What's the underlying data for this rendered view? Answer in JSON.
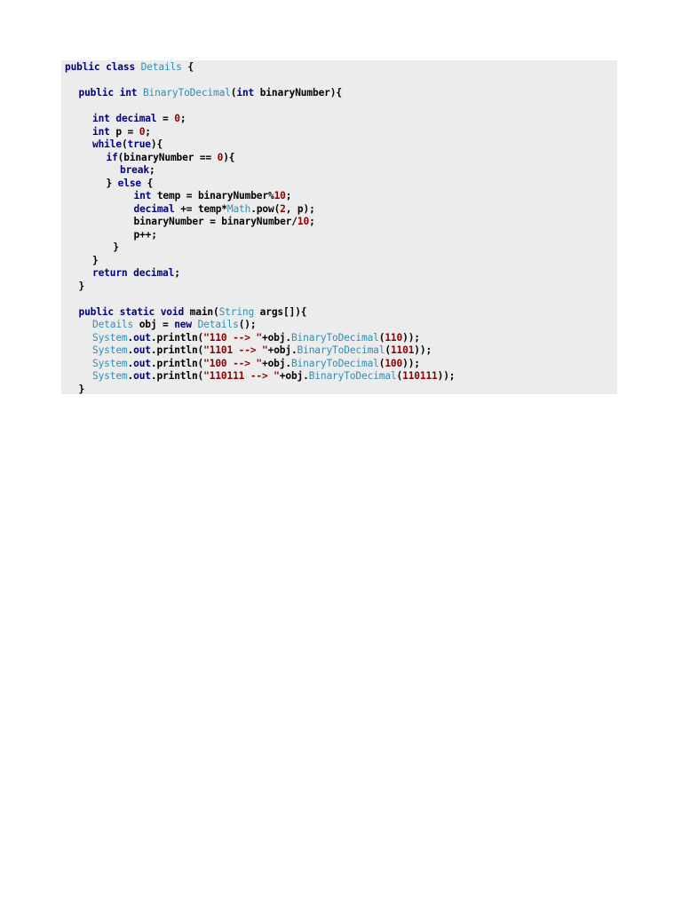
{
  "colors": {
    "background": "#ececec",
    "keyword": "#000080",
    "type": "#2e8fb4",
    "literal": "#8b0000",
    "text": "#000000"
  },
  "code": {
    "lines": [
      {
        "indent": 0,
        "tokens": [
          {
            "t": "public",
            "c": "kw"
          },
          {
            "t": " "
          },
          {
            "t": "class",
            "c": "kw"
          },
          {
            "t": " "
          },
          {
            "t": "Details",
            "c": "ty"
          },
          {
            "t": " {",
            "c": "id"
          }
        ]
      },
      {
        "indent": 0,
        "tokens": []
      },
      {
        "indent": 2,
        "tokens": [
          {
            "t": "public",
            "c": "kw"
          },
          {
            "t": " "
          },
          {
            "t": "int",
            "c": "kw"
          },
          {
            "t": " "
          },
          {
            "t": "BinaryToDecimal",
            "c": "ty"
          },
          {
            "t": "(",
            "c": "id"
          },
          {
            "t": "int",
            "c": "kw"
          },
          {
            "t": " binaryNumber){",
            "c": "id"
          }
        ]
      },
      {
        "indent": 0,
        "tokens": []
      },
      {
        "indent": 4,
        "tokens": [
          {
            "t": "int",
            "c": "kw"
          },
          {
            "t": " "
          },
          {
            "t": "decimal",
            "c": "kw"
          },
          {
            "t": " = ",
            "c": "id"
          },
          {
            "t": "0",
            "c": "num"
          },
          {
            "t": ";",
            "c": "id"
          }
        ]
      },
      {
        "indent": 4,
        "tokens": [
          {
            "t": "int",
            "c": "kw"
          },
          {
            "t": " p = ",
            "c": "id"
          },
          {
            "t": "0",
            "c": "num"
          },
          {
            "t": ";",
            "c": "id"
          }
        ]
      },
      {
        "indent": 4,
        "tokens": [
          {
            "t": "while",
            "c": "kw"
          },
          {
            "t": "(",
            "c": "id"
          },
          {
            "t": "true",
            "c": "kw"
          },
          {
            "t": "){",
            "c": "id"
          }
        ]
      },
      {
        "indent": 6,
        "tokens": [
          {
            "t": "if",
            "c": "kw"
          },
          {
            "t": "(binaryNumber == ",
            "c": "id"
          },
          {
            "t": "0",
            "c": "num"
          },
          {
            "t": "){",
            "c": "id"
          }
        ]
      },
      {
        "indent": 8,
        "tokens": [
          {
            "t": "break",
            "c": "kw"
          },
          {
            "t": ";",
            "c": "id"
          }
        ]
      },
      {
        "indent": 6,
        "tokens": [
          {
            "t": "} ",
            "c": "id"
          },
          {
            "t": "else",
            "c": "kw"
          },
          {
            "t": " {",
            "c": "id"
          }
        ]
      },
      {
        "indent": 10,
        "tokens": [
          {
            "t": "int",
            "c": "kw"
          },
          {
            "t": " temp = binaryNumber%",
            "c": "id"
          },
          {
            "t": "10",
            "c": "num"
          },
          {
            "t": ";",
            "c": "id"
          }
        ]
      },
      {
        "indent": 10,
        "tokens": [
          {
            "t": "decimal",
            "c": "kw"
          },
          {
            "t": " += temp*",
            "c": "id"
          },
          {
            "t": "Math",
            "c": "ty"
          },
          {
            "t": ".pow(",
            "c": "id"
          },
          {
            "t": "2",
            "c": "num"
          },
          {
            "t": ", p);",
            "c": "id"
          }
        ]
      },
      {
        "indent": 10,
        "tokens": [
          {
            "t": "binaryNumber = binaryNumber/",
            "c": "id"
          },
          {
            "t": "10",
            "c": "num"
          },
          {
            "t": ";",
            "c": "id"
          }
        ]
      },
      {
        "indent": 10,
        "tokens": [
          {
            "t": "p++;",
            "c": "id"
          }
        ]
      },
      {
        "indent": 7,
        "tokens": [
          {
            "t": "}",
            "c": "id"
          }
        ]
      },
      {
        "indent": 4,
        "tokens": [
          {
            "t": "}",
            "c": "id"
          }
        ]
      },
      {
        "indent": 4,
        "tokens": [
          {
            "t": "return",
            "c": "kw"
          },
          {
            "t": " "
          },
          {
            "t": "decimal",
            "c": "kw"
          },
          {
            "t": ";",
            "c": "id"
          }
        ]
      },
      {
        "indent": 2,
        "tokens": [
          {
            "t": "}",
            "c": "id"
          }
        ]
      },
      {
        "indent": 0,
        "tokens": []
      },
      {
        "indent": 2,
        "tokens": [
          {
            "t": "public",
            "c": "kw"
          },
          {
            "t": " "
          },
          {
            "t": "static",
            "c": "kw"
          },
          {
            "t": " "
          },
          {
            "t": "void",
            "c": "kw"
          },
          {
            "t": " main(",
            "c": "id"
          },
          {
            "t": "String",
            "c": "ty"
          },
          {
            "t": " args[]){",
            "c": "id"
          }
        ]
      },
      {
        "indent": 4,
        "tokens": [
          {
            "t": "Details",
            "c": "ty"
          },
          {
            "t": " obj = ",
            "c": "id"
          },
          {
            "t": "new",
            "c": "kw"
          },
          {
            "t": " "
          },
          {
            "t": "Details",
            "c": "ty"
          },
          {
            "t": "();",
            "c": "id"
          }
        ]
      },
      {
        "indent": 4,
        "tokens": [
          {
            "t": "System",
            "c": "ty"
          },
          {
            "t": ".",
            "c": "id"
          },
          {
            "t": "out",
            "c": "kw"
          },
          {
            "t": ".println(",
            "c": "id"
          },
          {
            "t": "\"110 --> \"",
            "c": "str"
          },
          {
            "t": "+obj.",
            "c": "id"
          },
          {
            "t": "BinaryToDecimal",
            "c": "ty"
          },
          {
            "t": "(",
            "c": "id"
          },
          {
            "t": "110",
            "c": "num"
          },
          {
            "t": "));",
            "c": "id"
          }
        ]
      },
      {
        "indent": 4,
        "tokens": [
          {
            "t": "System",
            "c": "ty"
          },
          {
            "t": ".",
            "c": "id"
          },
          {
            "t": "out",
            "c": "kw"
          },
          {
            "t": ".println(",
            "c": "id"
          },
          {
            "t": "\"1101 --> \"",
            "c": "str"
          },
          {
            "t": "+obj.",
            "c": "id"
          },
          {
            "t": "BinaryToDecimal",
            "c": "ty"
          },
          {
            "t": "(",
            "c": "id"
          },
          {
            "t": "1101",
            "c": "num"
          },
          {
            "t": "));",
            "c": "id"
          }
        ]
      },
      {
        "indent": 4,
        "tokens": [
          {
            "t": "System",
            "c": "ty"
          },
          {
            "t": ".",
            "c": "id"
          },
          {
            "t": "out",
            "c": "kw"
          },
          {
            "t": ".println(",
            "c": "id"
          },
          {
            "t": "\"100 --> \"",
            "c": "str"
          },
          {
            "t": "+obj.",
            "c": "id"
          },
          {
            "t": "BinaryToDecimal",
            "c": "ty"
          },
          {
            "t": "(",
            "c": "id"
          },
          {
            "t": "100",
            "c": "num"
          },
          {
            "t": "));",
            "c": "id"
          }
        ]
      },
      {
        "indent": 4,
        "tokens": [
          {
            "t": "System",
            "c": "ty"
          },
          {
            "t": ".",
            "c": "id"
          },
          {
            "t": "out",
            "c": "kw"
          },
          {
            "t": ".println(",
            "c": "id"
          },
          {
            "t": "\"110111 --> \"",
            "c": "str"
          },
          {
            "t": "+obj.",
            "c": "id"
          },
          {
            "t": "BinaryToDecimal",
            "c": "ty"
          },
          {
            "t": "(",
            "c": "id"
          },
          {
            "t": "110111",
            "c": "num"
          },
          {
            "t": "));",
            "c": "id"
          }
        ]
      },
      {
        "indent": 2,
        "tokens": [
          {
            "t": "}",
            "c": "id"
          }
        ]
      }
    ]
  }
}
